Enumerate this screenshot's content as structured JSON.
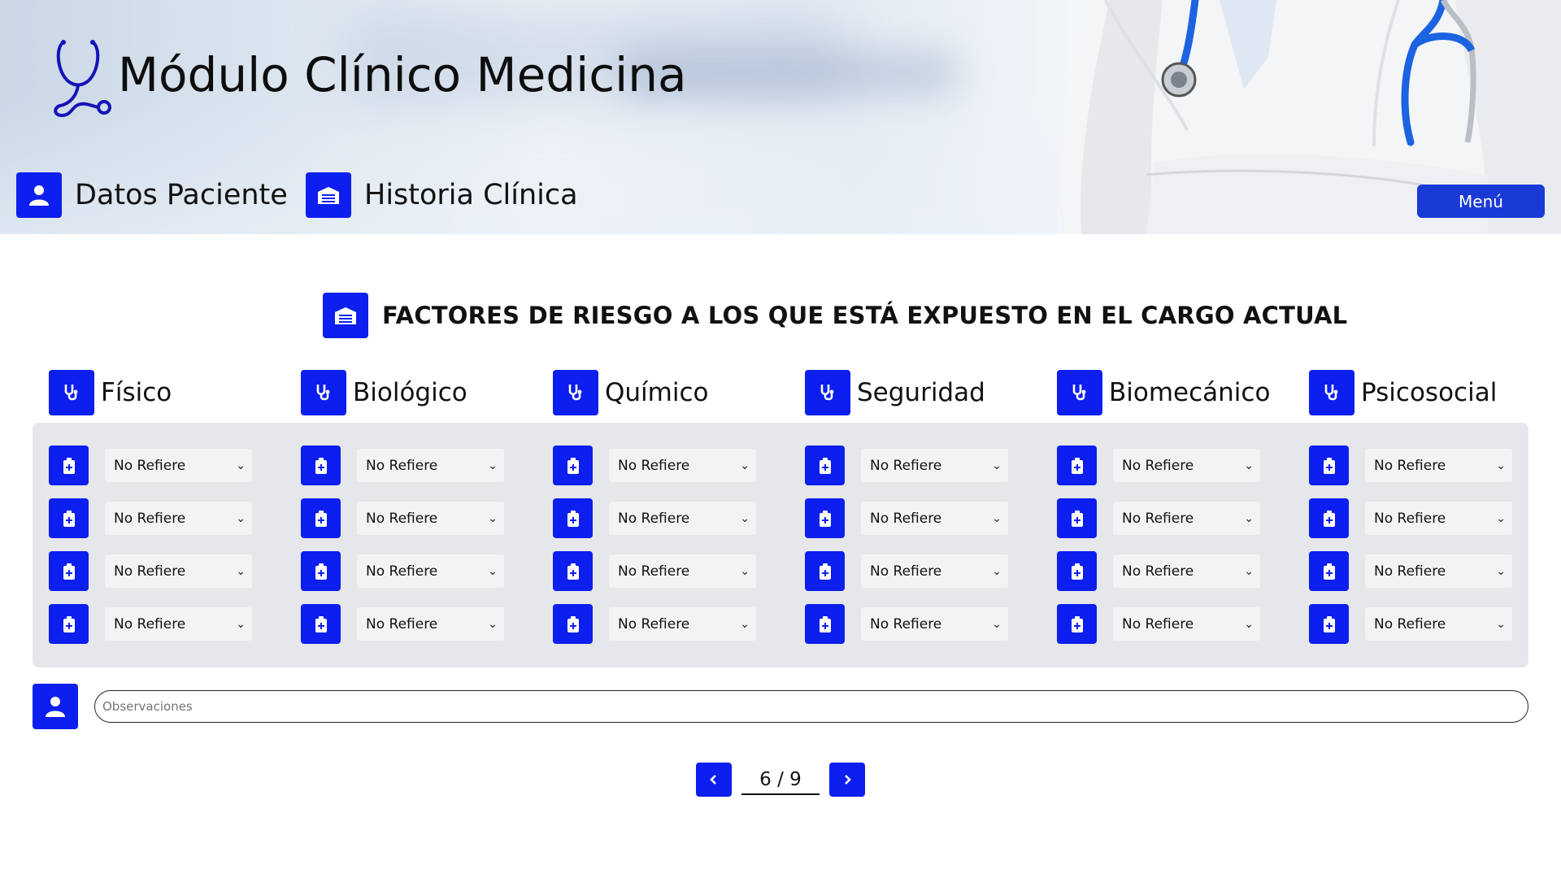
{
  "header": {
    "title": "Módulo Clínico Medicina",
    "nav": [
      {
        "label": "Datos Paciente",
        "icon": "user-icon"
      },
      {
        "label": "Historia Clínica",
        "icon": "clinic-icon"
      }
    ],
    "menu_label": "Menú"
  },
  "section": {
    "title": "FACTORES DE RIESGO A LOS QUE ESTÁ EXPUESTO EN EL CARGO ACTUAL",
    "icon": "clinic-icon"
  },
  "categories": [
    {
      "label": "Físico",
      "icon": "stethoscope-icon"
    },
    {
      "label": "Biológico",
      "icon": "stethoscope-icon"
    },
    {
      "label": "Químico",
      "icon": "stethoscope-icon"
    },
    {
      "label": "Seguridad",
      "icon": "stethoscope-icon"
    },
    {
      "label": "Biomecánico",
      "icon": "stethoscope-icon"
    },
    {
      "label": "Psicosocial",
      "icon": "stethoscope-icon"
    }
  ],
  "select_value": "No Refiere",
  "rows_per_category": 4,
  "observaciones": {
    "placeholder": "Observaciones",
    "value": ""
  },
  "pagination": {
    "text": "6 / 9"
  },
  "colors": {
    "primary": "#0d1fee",
    "menu": "#1a3ad6",
    "panel": "#e6e7ea"
  }
}
